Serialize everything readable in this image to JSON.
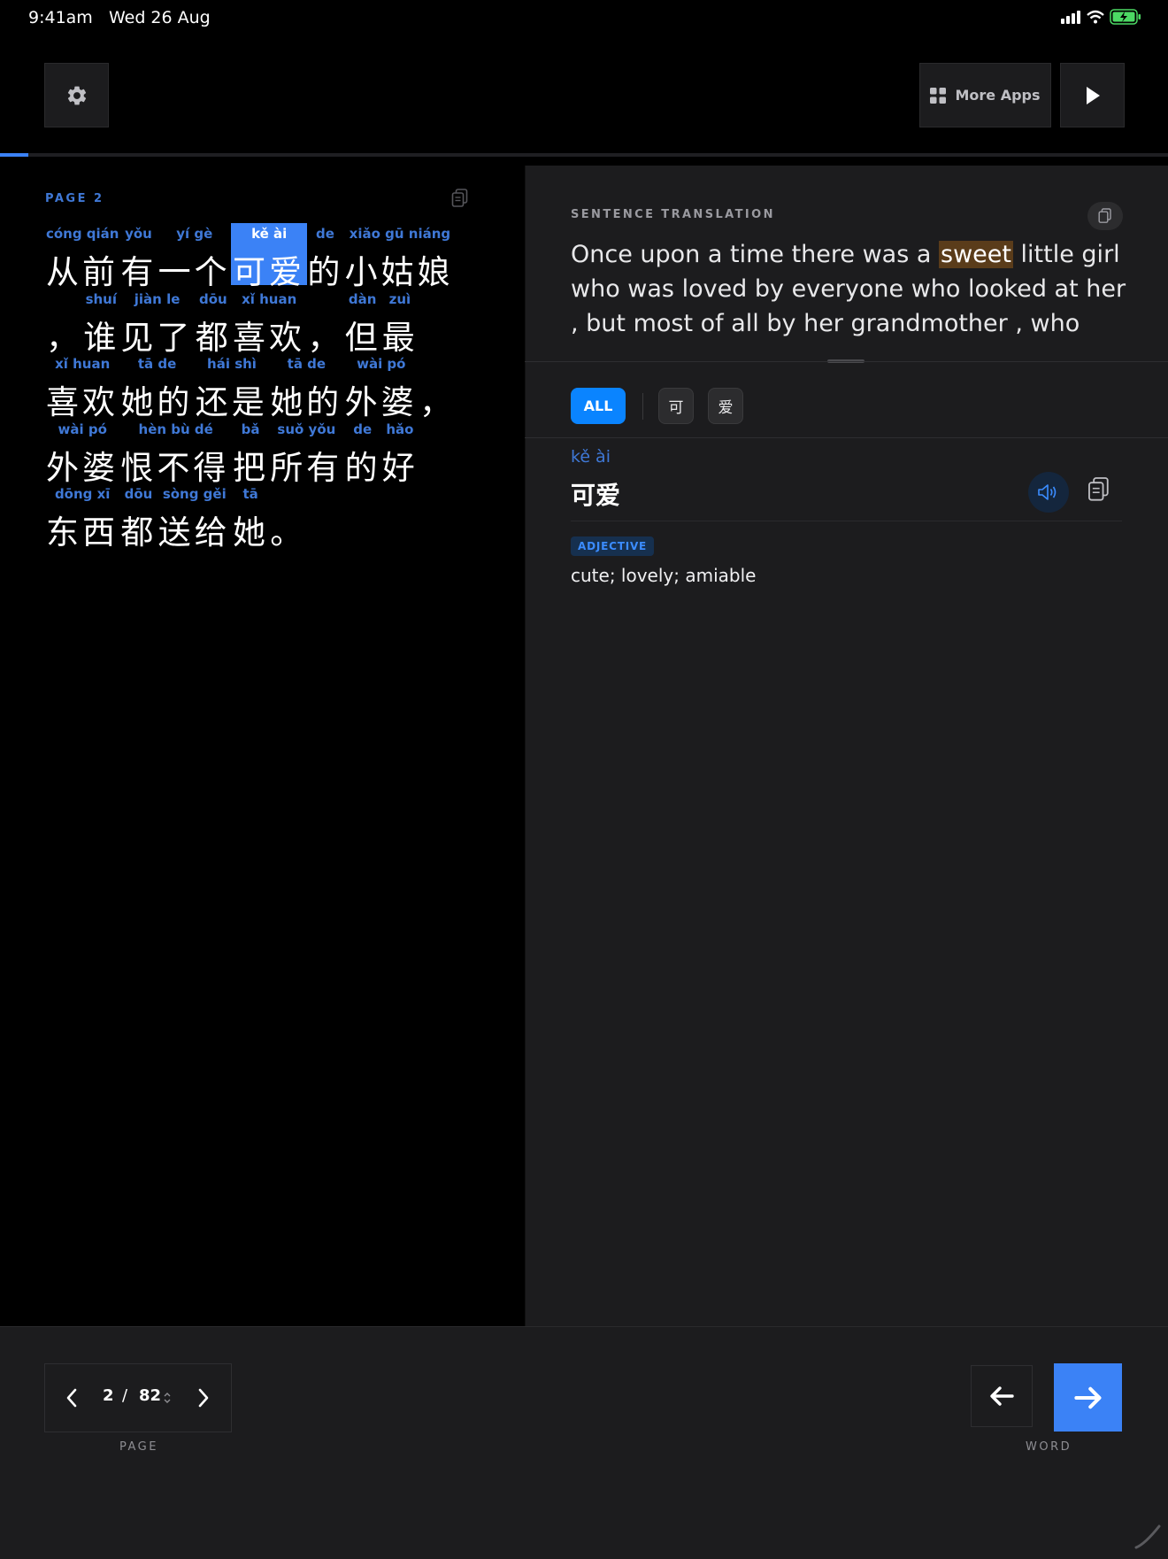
{
  "status": {
    "time": "9:41am",
    "date": "Wed 26 Aug"
  },
  "toolbar": {
    "more_apps_label": "More Apps"
  },
  "progress": {
    "fraction": 0.0244
  },
  "reader": {
    "page_label": "PAGE 2",
    "lines": [
      [
        {
          "py": "cóng qián",
          "hz": "从前",
          "w": 2
        },
        {
          "py": "yǒu",
          "hz": "有",
          "w": 1
        },
        {
          "py": "yí gè",
          "hz": "一个",
          "w": 2
        },
        {
          "py": "kě ài",
          "hz": "可爱",
          "w": 2,
          "sel": true
        },
        {
          "py": "de",
          "hz": "的",
          "w": 1
        },
        {
          "py": "xiǎo gū niáng",
          "hz": "小姑娘",
          "w": 3
        }
      ],
      [
        {
          "py": "",
          "hz": "，",
          "w": 1
        },
        {
          "py": "shuí",
          "hz": "谁",
          "w": 1
        },
        {
          "py": "jiàn le",
          "hz": "见了",
          "w": 2
        },
        {
          "py": "dōu",
          "hz": "都",
          "w": 1
        },
        {
          "py": "xǐ huan",
          "hz": "喜欢",
          "w": 2
        },
        {
          "py": "",
          "hz": "，",
          "w": 1
        },
        {
          "py": "dàn",
          "hz": "但",
          "w": 1
        },
        {
          "py": "zuì",
          "hz": "最",
          "w": 1
        }
      ],
      [
        {
          "py": "xǐ huan",
          "hz": "喜欢",
          "w": 2
        },
        {
          "py": "tā de",
          "hz": "她的",
          "w": 2
        },
        {
          "py": "hái shì",
          "hz": "还是",
          "w": 2
        },
        {
          "py": "tā de",
          "hz": "她的",
          "w": 2
        },
        {
          "py": "wài pó",
          "hz": "外婆",
          "w": 2
        },
        {
          "py": "",
          "hz": "，",
          "w": 1
        }
      ],
      [
        {
          "py": "wài pó",
          "hz": "外婆",
          "w": 2
        },
        {
          "py": "hèn bù dé",
          "hz": "恨不得",
          "w": 3
        },
        {
          "py": "bǎ",
          "hz": "把",
          "w": 1
        },
        {
          "py": "suǒ yǒu",
          "hz": "所有",
          "w": 2
        },
        {
          "py": "de",
          "hz": "的",
          "w": 1
        },
        {
          "py": "hǎo",
          "hz": "好",
          "w": 1
        }
      ],
      [
        {
          "py": "dōng xī",
          "hz": "东西",
          "w": 2
        },
        {
          "py": "dōu",
          "hz": "都",
          "w": 1
        },
        {
          "py": "sòng gěi",
          "hz": "送给",
          "w": 2
        },
        {
          "py": "tā",
          "hz": "她",
          "w": 1
        },
        {
          "py": "",
          "hz": "。",
          "w": 1
        }
      ]
    ]
  },
  "translation": {
    "heading": "SENTENCE TRANSLATION",
    "before": "Once upon a time there was a ",
    "highlight": "sweet",
    "after": " little girl who was loved by everyone who looked at her , but most of all by her grandmother , who"
  },
  "word_filter": {
    "all_label": "ALL",
    "chars": [
      "可",
      "爱"
    ]
  },
  "word": {
    "pinyin": "kě ài",
    "hanzi": "可爱",
    "pos": "ADJECTIVE",
    "meaning": "cute; lovely; amiable"
  },
  "pager": {
    "current": "2",
    "separator": "/",
    "total": "82",
    "label": "PAGE"
  },
  "word_nav": {
    "label": "WORD"
  },
  "colors": {
    "accent": "#3b82f6",
    "pinyin": "#3f78d6",
    "panel": "#1c1c1e",
    "highlight": "#5a3c1a"
  }
}
